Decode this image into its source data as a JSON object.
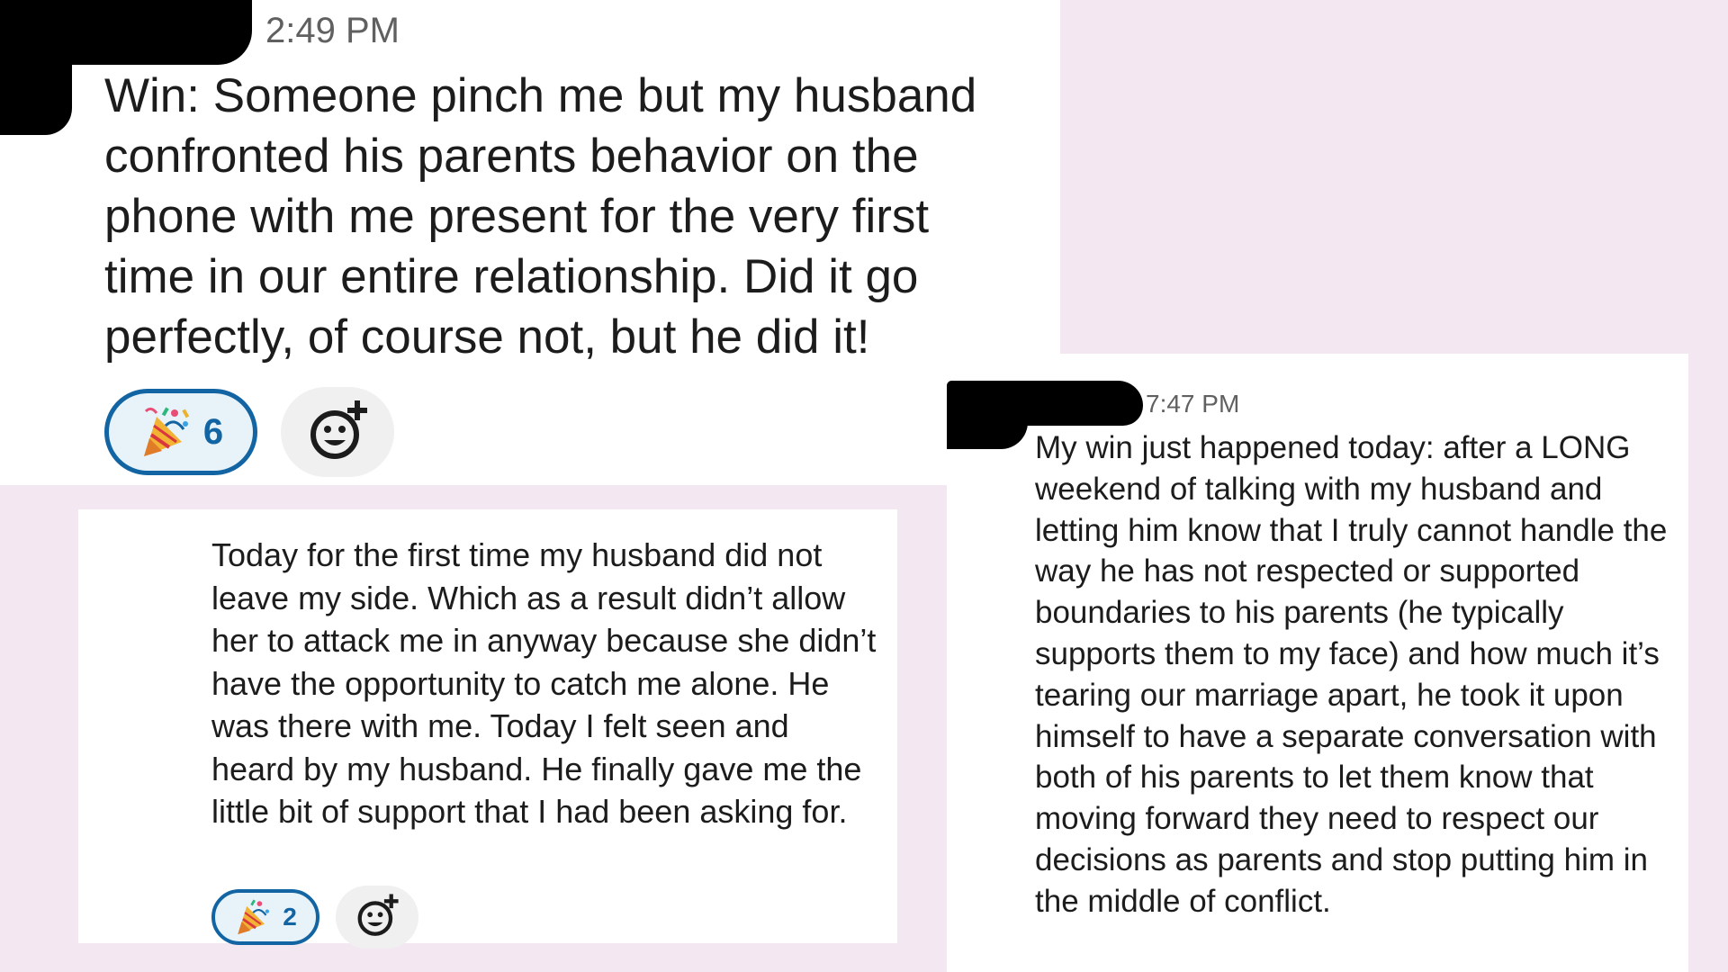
{
  "posts": [
    {
      "timestamp": "2:49 PM",
      "text": "Win: Someone pinch me but my husband confronted his parents behavior on the phone with me present for the very first time in our entire relationship. Did it go perfectly, of course not, but he did it!",
      "reaction": {
        "emoji": "party-popper-icon",
        "count": "6"
      }
    },
    {
      "text": "Today for the first time my husband did not leave my side. Which as a result didn’t allow her to attack me in anyway because she didn’t have the opportunity to catch me alone. He was there with me. Today I felt seen and heard by my husband. He finally gave me the little bit of support that I had been asking for.",
      "reaction": {
        "emoji": "party-popper-icon",
        "count": "2"
      }
    },
    {
      "timestamp": "7:47 PM",
      "text": "My win just happened today: after a LONG weekend of talking with my husband and letting him know that I truly cannot handle the way he has not respected or supported boundaries to his parents (he typically supports them to my face) and how much it’s tearing our marriage apart, he took it upon himself to have a separate conversation with both of his parents to let them know that moving forward they need to respect our decisions as parents and stop putting him in the middle of conflict."
    }
  ],
  "colors": {
    "background": "#f3e8f1",
    "panel": "#ffffff",
    "reaction_border": "#1264a3",
    "reaction_fill": "#e8f3f9",
    "timestamp": "#616061",
    "text": "#1d1c1d",
    "redaction": "#000000"
  }
}
